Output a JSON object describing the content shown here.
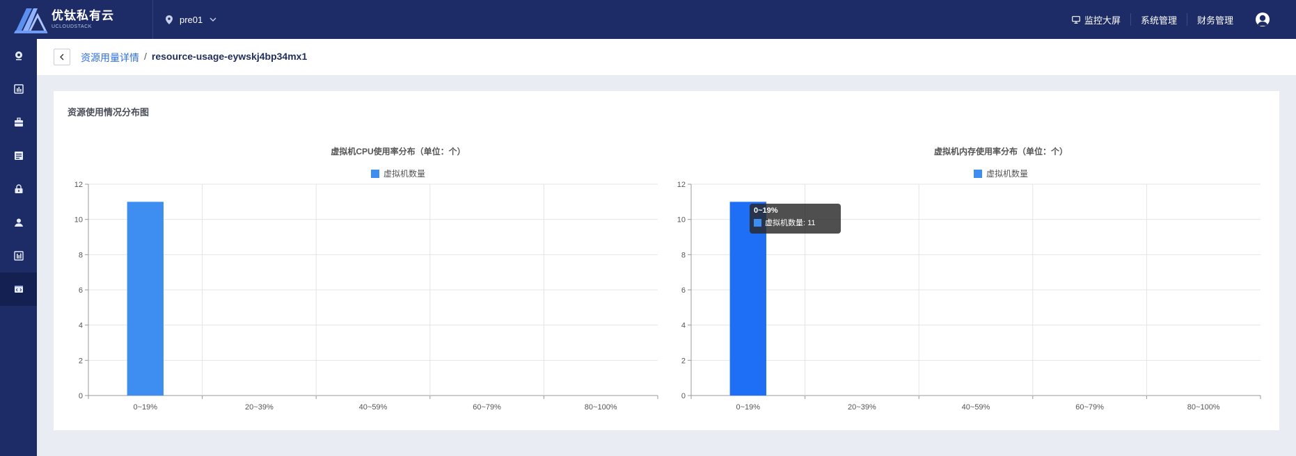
{
  "header": {
    "logo_cn": "优钛私有云",
    "logo_en": "UCLOUDSTACK",
    "region": "pre01",
    "links": [
      {
        "label": "监控大屏",
        "icon": "monitor-icon"
      },
      {
        "label": "系统管理",
        "icon": ""
      },
      {
        "label": "财务管理",
        "icon": ""
      }
    ],
    "user_icon": "user-avatar-icon"
  },
  "sidebar": {
    "items": [
      {
        "icon": "location-icon",
        "active": false
      },
      {
        "icon": "dashboard-icon",
        "active": false
      },
      {
        "icon": "briefcase-icon",
        "active": false
      },
      {
        "icon": "storage-icon",
        "active": false
      },
      {
        "icon": "lock-icon",
        "active": false
      },
      {
        "icon": "user-manage-icon",
        "active": false
      },
      {
        "icon": "bar-stats-icon",
        "active": false
      },
      {
        "icon": "code-window-icon",
        "active": true
      }
    ]
  },
  "breadcrumb": {
    "parent": "资源用量详情",
    "separator": "/",
    "current": "resource-usage-eywskj4bp34mx1"
  },
  "card": {
    "title": "资源使用情况分布图"
  },
  "colors": {
    "topbar": "#1d2b66",
    "bar_normal": "#3d8ef0",
    "bar_highlight": "#1e6ff5",
    "link": "#2e6fd9"
  },
  "chart_data": [
    {
      "type": "bar",
      "title": "虚拟机CPU使用率分布（单位：个）",
      "categories": [
        "0~19%",
        "20~39%",
        "40~59%",
        "60~79%",
        "80~100%"
      ],
      "series": [
        {
          "name": "虚拟机数量",
          "values": [
            11,
            0,
            0,
            0,
            0
          ]
        }
      ],
      "ylim": [
        0,
        12
      ],
      "yticks": [
        0,
        2,
        4,
        6,
        8,
        10,
        12
      ],
      "grid": true,
      "legend": "top-center"
    },
    {
      "type": "bar",
      "title": "虚拟机内存使用率分布（单位：个）",
      "categories": [
        "0~19%",
        "20~39%",
        "40~59%",
        "60~79%",
        "80~100%"
      ],
      "series": [
        {
          "name": "虚拟机数量",
          "values": [
            11,
            0,
            0,
            0,
            0
          ]
        }
      ],
      "ylim": [
        0,
        12
      ],
      "yticks": [
        0,
        2,
        4,
        6,
        8,
        10,
        12
      ],
      "grid": true,
      "legend": "top-center",
      "highlighted_index": 0,
      "tooltip": {
        "title": "0~19%",
        "label": "虚拟机数量: 11"
      }
    }
  ]
}
